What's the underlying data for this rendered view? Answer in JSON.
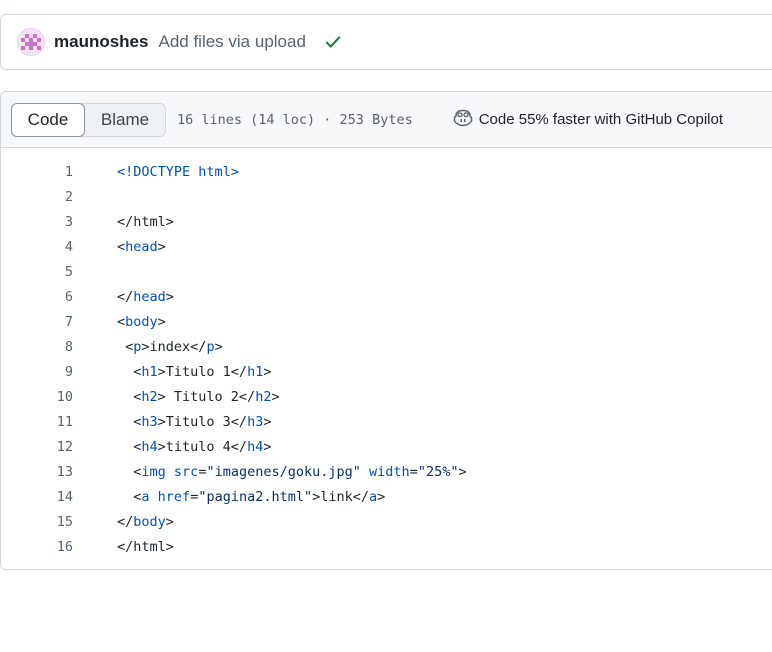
{
  "commit": {
    "author": "maunoshes",
    "message": "Add files via upload",
    "status": "check-icon"
  },
  "file_header": {
    "tabs": [
      {
        "label": "Code",
        "selected": true
      },
      {
        "label": "Blame",
        "selected": false
      }
    ],
    "info": "16 lines (14 loc) · 253 Bytes",
    "copilot_label": "Code 55% faster with GitHub Copilot"
  },
  "colors": {
    "tag": "#0550ae",
    "string": "#0a3069",
    "text": "#1f2328",
    "muted": "#59636e",
    "success": "#1a7f37"
  },
  "code": {
    "lines": [
      {
        "num": "1",
        "tokens": [
          [
            "t",
            "<!DOCTYPE html>"
          ]
        ]
      },
      {
        "num": "2",
        "tokens": []
      },
      {
        "num": "3",
        "tokens": [
          [
            "p",
            "</html>"
          ]
        ]
      },
      {
        "num": "4",
        "tokens": [
          [
            "p",
            "<"
          ],
          [
            "t",
            "head"
          ],
          [
            "p",
            ">"
          ]
        ]
      },
      {
        "num": "5",
        "tokens": []
      },
      {
        "num": "6",
        "tokens": [
          [
            "p",
            "</"
          ],
          [
            "t",
            "head"
          ],
          [
            "p",
            ">"
          ]
        ]
      },
      {
        "num": "7",
        "tokens": [
          [
            "p",
            "<"
          ],
          [
            "t",
            "body"
          ],
          [
            "p",
            ">"
          ]
        ]
      },
      {
        "num": "8",
        "tokens": [
          [
            "p",
            " <"
          ],
          [
            "t",
            "p"
          ],
          [
            "p",
            ">index</"
          ],
          [
            "t",
            "p"
          ],
          [
            "p",
            ">"
          ]
        ]
      },
      {
        "num": "9",
        "tokens": [
          [
            "p",
            "  <"
          ],
          [
            "t",
            "h1"
          ],
          [
            "p",
            ">Titulo 1</"
          ],
          [
            "t",
            "h1"
          ],
          [
            "p",
            ">"
          ]
        ]
      },
      {
        "num": "10",
        "tokens": [
          [
            "p",
            "  <"
          ],
          [
            "t",
            "h2"
          ],
          [
            "p",
            "> Titulo 2</"
          ],
          [
            "t",
            "h2"
          ],
          [
            "p",
            ">"
          ]
        ]
      },
      {
        "num": "11",
        "tokens": [
          [
            "p",
            "  <"
          ],
          [
            "t",
            "h3"
          ],
          [
            "p",
            ">Titulo 3</"
          ],
          [
            "t",
            "h3"
          ],
          [
            "p",
            ">"
          ]
        ]
      },
      {
        "num": "12",
        "tokens": [
          [
            "p",
            "  <"
          ],
          [
            "t",
            "h4"
          ],
          [
            "p",
            ">titulo 4</"
          ],
          [
            "t",
            "h4"
          ],
          [
            "p",
            ">"
          ]
        ]
      },
      {
        "num": "13",
        "tokens": [
          [
            "p",
            "  <"
          ],
          [
            "t",
            "img"
          ],
          [
            "p",
            " "
          ],
          [
            "a",
            "src"
          ],
          [
            "p",
            "="
          ],
          [
            "s",
            "\"imagenes/goku.jpg\""
          ],
          [
            "p",
            " "
          ],
          [
            "a",
            "width"
          ],
          [
            "p",
            "="
          ],
          [
            "s",
            "\"25%\""
          ],
          [
            "p",
            ">"
          ]
        ]
      },
      {
        "num": "14",
        "tokens": [
          [
            "p",
            "  <"
          ],
          [
            "t",
            "a"
          ],
          [
            "p",
            " "
          ],
          [
            "a",
            "href"
          ],
          [
            "p",
            "="
          ],
          [
            "s",
            "\"pagina2.html\""
          ],
          [
            "p",
            ">link</"
          ],
          [
            "t",
            "a"
          ],
          [
            "p",
            ">"
          ]
        ]
      },
      {
        "num": "15",
        "tokens": [
          [
            "p",
            "</"
          ],
          [
            "t",
            "body"
          ],
          [
            "p",
            ">"
          ]
        ]
      },
      {
        "num": "16",
        "tokens": [
          [
            "p",
            "</html>"
          ]
        ]
      }
    ]
  }
}
